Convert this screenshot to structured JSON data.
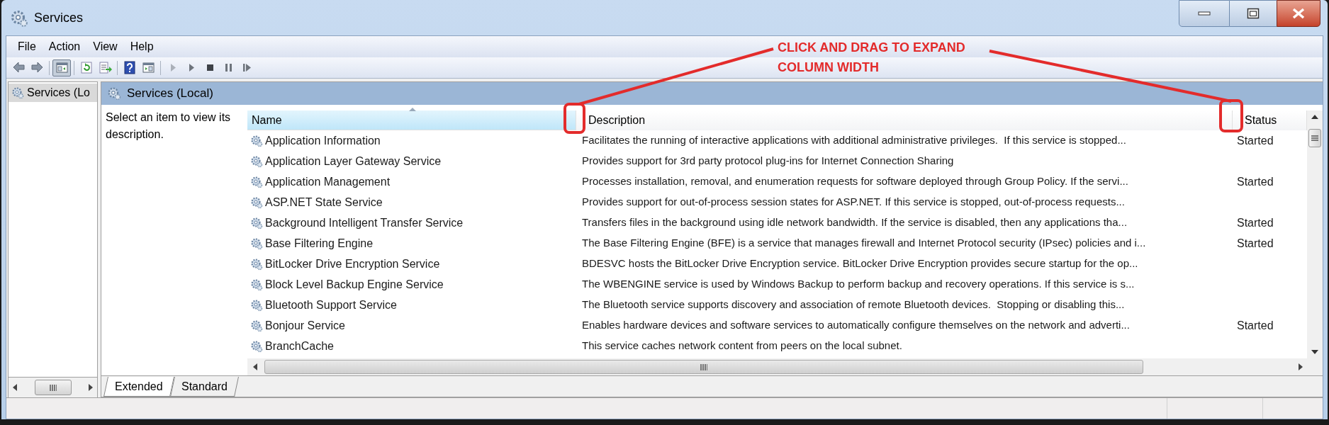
{
  "window": {
    "title": "Services"
  },
  "menu": [
    "File",
    "Action",
    "View",
    "Help"
  ],
  "toolbar": [
    [
      {
        "kind": "back",
        "pressed": false,
        "disabled": false
      },
      {
        "kind": "forward",
        "pressed": false,
        "disabled": false
      }
    ],
    [
      {
        "kind": "tree",
        "pressed": true,
        "disabled": false
      }
    ],
    [
      {
        "kind": "refresh",
        "pressed": false,
        "disabled": false
      },
      {
        "kind": "export",
        "pressed": false,
        "disabled": false
      }
    ],
    [
      {
        "kind": "help",
        "pressed": false,
        "disabled": false
      },
      {
        "kind": "properties",
        "pressed": false,
        "disabled": false
      }
    ],
    [
      {
        "kind": "play",
        "pressed": false,
        "disabled": true
      },
      {
        "kind": "play",
        "pressed": false,
        "disabled": false
      },
      {
        "kind": "stop",
        "pressed": false,
        "disabled": false
      },
      {
        "kind": "pause",
        "pressed": false,
        "disabled": false
      },
      {
        "kind": "resume",
        "pressed": false,
        "disabled": false
      }
    ]
  ],
  "tree": [
    {
      "label": "Services (Lo",
      "selected": true
    }
  ],
  "panel": {
    "title": "Services (Local)",
    "hint": "Select an item to view its description."
  },
  "table": {
    "columns": [
      {
        "label": "Name",
        "sorted": true
      },
      {
        "label": "Description",
        "sorted": false
      },
      {
        "label": "Status",
        "sorted": false
      }
    ],
    "rows": [
      {
        "name": "Application Information",
        "description": "Facilitates the running of interactive applications with additional administrative privileges.  If this service is stopped...",
        "status": "Started"
      },
      {
        "name": "Application Layer Gateway Service",
        "description": "Provides support for 3rd party protocol plug-ins for Internet Connection Sharing"
      },
      {
        "name": "Application Management",
        "description": "Processes installation, removal, and enumeration requests for software deployed through Group Policy. If the servi...",
        "status": "Started"
      },
      {
        "name": "ASP.NET State Service",
        "description": "Provides support for out-of-process session states for ASP.NET. If this service is stopped, out-of-process requests..."
      },
      {
        "name": "Background Intelligent Transfer Service",
        "description": "Transfers files in the background using idle network bandwidth. If the service is disabled, then any applications tha...",
        "status": "Started"
      },
      {
        "name": "Base Filtering Engine",
        "description": "The Base Filtering Engine (BFE) is a service that manages firewall and Internet Protocol security (IPsec) policies and i...",
        "status": "Started"
      },
      {
        "name": "BitLocker Drive Encryption Service",
        "description": "BDESVC hosts the BitLocker Drive Encryption service. BitLocker Drive Encryption provides secure startup for the op..."
      },
      {
        "name": "Block Level Backup Engine Service",
        "description": "The WBENGINE service is used by Windows Backup to perform backup and recovery operations. If this service is s..."
      },
      {
        "name": "Bluetooth Support Service",
        "description": "The Bluetooth service supports discovery and association of remote Bluetooth devices.  Stopping or disabling this..."
      },
      {
        "name": "Bonjour Service",
        "description": "Enables hardware devices and software services to automatically configure themselves on the network and adverti...",
        "status": "Started"
      },
      {
        "name": "BranchCache",
        "description": "This service caches network content from peers on the local subnet."
      }
    ]
  },
  "view_tabs": [
    {
      "label": "Extended",
      "selected": true
    },
    {
      "label": "Standard",
      "selected": false
    }
  ],
  "annotation": {
    "lines": [
      "CLICK AND DRAG TO EXPAND",
      "COLUMN WIDTH"
    ]
  }
}
